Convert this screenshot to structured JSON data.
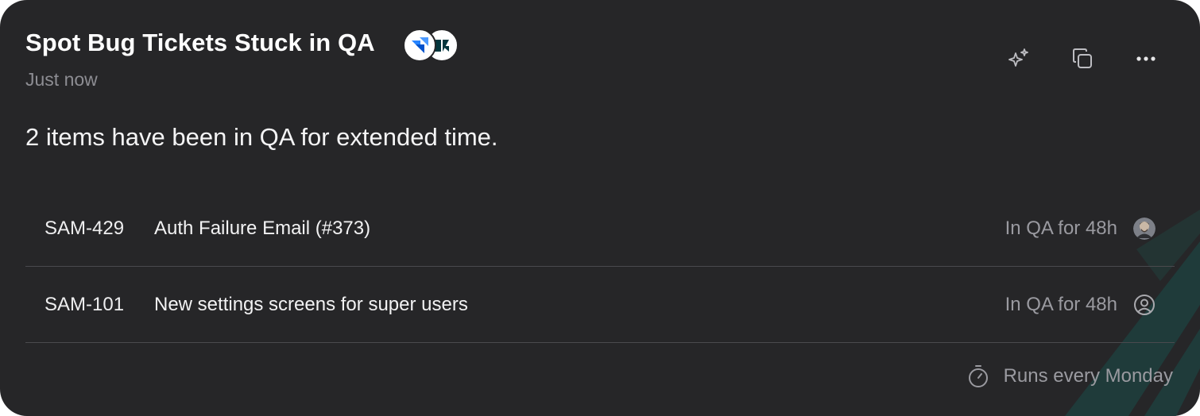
{
  "card": {
    "title": "Spot Bug Tickets Stuck in QA",
    "timestamp": "Just now",
    "summary": "2 items have been in QA for extended time.",
    "integrations": [
      {
        "icon": "jira-icon",
        "color": "#2684FF"
      },
      {
        "icon": "zendesk-icon",
        "color": "#03363D"
      }
    ],
    "toolbar": [
      {
        "icon": "sparkles-icon"
      },
      {
        "icon": "copy-icon"
      },
      {
        "icon": "more-icon"
      }
    ],
    "items": [
      {
        "key": "SAM-429",
        "title": "Auth Failure Email (#373)",
        "status": "In QA for 48h",
        "assignee": "avatar-photo"
      },
      {
        "key": "SAM-101",
        "title": "New settings screens for super users",
        "status": "In QA for 48h",
        "assignee": "user-placeholder-icon"
      }
    ],
    "schedule": {
      "icon": "timer-icon",
      "label": "Runs every Monday"
    }
  },
  "colors": {
    "card_bg": "#262628",
    "text_primary": "#F2F2F3",
    "text_muted": "#8D8D93",
    "divider": "#4A4A4E",
    "accent_teal": "#1E4A48"
  }
}
